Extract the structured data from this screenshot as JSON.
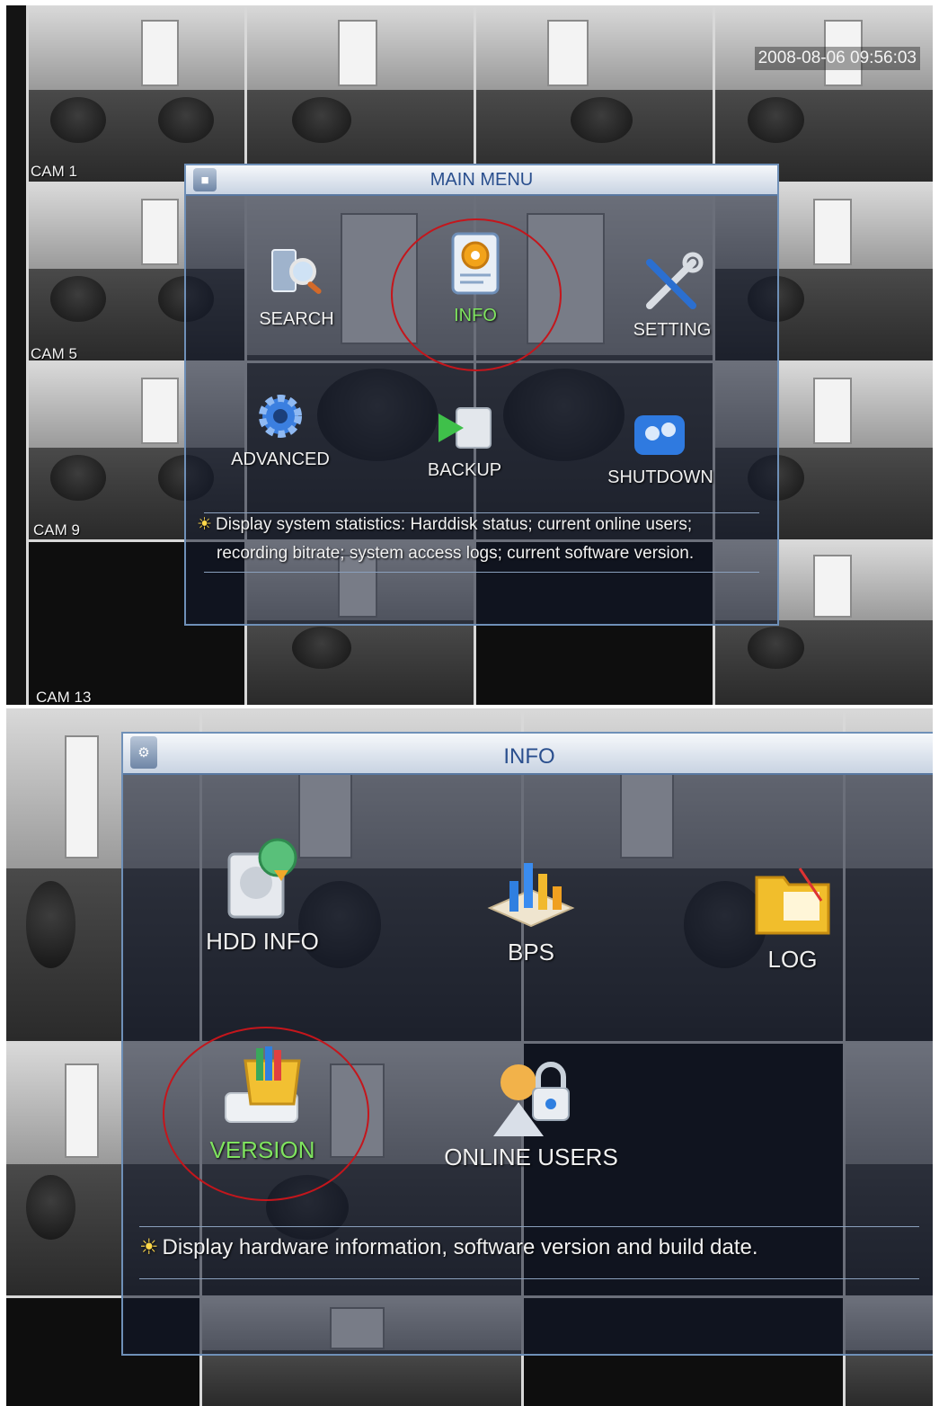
{
  "screen1": {
    "timestamp": "2008-08-06 09:56:03",
    "cameras": [
      "CAM 1",
      "CAM 5",
      "CAM 9",
      "CAM 13"
    ],
    "menu_title": "MAIN MENU",
    "items": [
      {
        "label": "SEARCH",
        "icon": "search-icon"
      },
      {
        "label": "INFO",
        "icon": "info-icon",
        "selected": true
      },
      {
        "label": "SETTING",
        "icon": "setting-icon"
      },
      {
        "label": "ADVANCED",
        "icon": "advanced-icon"
      },
      {
        "label": "BACKUP",
        "icon": "backup-icon"
      },
      {
        "label": "SHUTDOWN",
        "icon": "shutdown-icon"
      }
    ],
    "hint_line1": "Display system statistics: Harddisk status; current online users;",
    "hint_line2": "recording bitrate; system access logs; current software version."
  },
  "screen2": {
    "menu_title": "INFO",
    "items": [
      {
        "label": "HDD INFO",
        "icon": "hdd-info-icon"
      },
      {
        "label": "BPS",
        "icon": "bps-icon"
      },
      {
        "label": "LOG",
        "icon": "log-icon"
      },
      {
        "label": "VERSION",
        "icon": "version-icon",
        "selected": true
      },
      {
        "label": "ONLINE USERS",
        "icon": "online-users-icon"
      }
    ],
    "hint": "Display hardware information, software version and build date."
  },
  "colors": {
    "selected_label": "#7fe35f",
    "highlight_circle": "#c4161c",
    "menu_title": "#2a4f8e",
    "menu_border": "#6f90b8"
  }
}
